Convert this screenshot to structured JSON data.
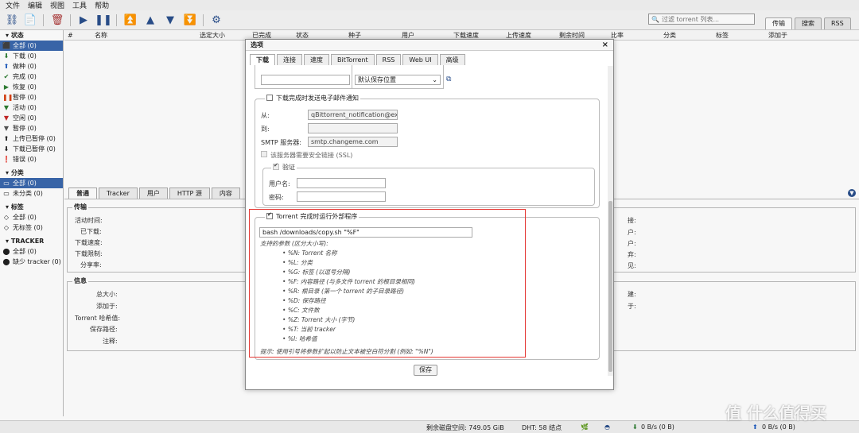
{
  "menu": {
    "file": "文件",
    "edit": "编辑",
    "view": "视图",
    "tools": "工具",
    "help": "帮助"
  },
  "search": {
    "placeholder": "过滤 torrent 列表..."
  },
  "right_tabs": [
    "传输",
    "搜索",
    "RSS"
  ],
  "sidebar": {
    "status_header": "状态",
    "status_items": [
      "全部 (0)",
      "下载 (0)",
      "做种 (0)",
      "完成 (0)",
      "恢复 (0)",
      "暂停 (0)",
      "活动 (0)",
      "空闲 (0)",
      "暂停 (0)",
      "上传已暂停 (0)",
      "下载已暂停 (0)",
      "错误 (0)"
    ],
    "category_header": "分类",
    "category_items": [
      "全部 (0)",
      "未分类 (0)"
    ],
    "tag_header": "标签",
    "tag_items": [
      "全部 (0)",
      "无标签 (0)"
    ],
    "tracker_header": "TRACKER",
    "tracker_items": [
      "全部 (0)",
      "缺少 tracker (0)"
    ]
  },
  "columns": [
    "#",
    "名称",
    "选定大小",
    "已完成",
    "状态",
    "种子",
    "用户",
    "下载速度",
    "上传速度",
    "剩余时间",
    "比率",
    "分类",
    "标签",
    "添加于"
  ],
  "bottom_tabs": [
    "普通",
    "Tracker",
    "用户",
    "HTTP 源",
    "内容"
  ],
  "transfer": {
    "legend": "传输",
    "labels": [
      "活动时间:",
      "已下载:",
      "下载速度:",
      "下载限制:",
      "分享率:"
    ],
    "right_labels": [
      "接:",
      "户:",
      "户:",
      "弃:",
      "见:"
    ]
  },
  "info": {
    "legend": "信息",
    "labels": [
      "总大小:",
      "添加于:",
      "Torrent 哈希值:",
      "保存路径:",
      "注释:"
    ],
    "right_labels": [
      "建:",
      "于:"
    ]
  },
  "status_bar": {
    "disk": "剩余磁盘空间: 749.05 GiB",
    "dht": "DHT: 58 结点",
    "down": "0 B/s (0 B)",
    "up": "0 B/s (0 B)"
  },
  "dialog": {
    "title": "选项",
    "close": "×",
    "tabs": [
      "下载",
      "连接",
      "速度",
      "BitTorrent",
      "RSS",
      "Web UI",
      "高级"
    ],
    "save_path_select": "默认保存位置",
    "email": {
      "legend": "下载完成时发送电子邮件通知",
      "from_label": "从:",
      "from_value": "qBittorrent_notification@exa",
      "to_label": "到:",
      "smtp_label": "SMTP 服务器:",
      "smtp_value": "smtp.changeme.com",
      "ssl_label": "该服务器需要安全链接 (SSL)",
      "auth_legend": "验证",
      "user_label": "用户名:",
      "pass_label": "密码:"
    },
    "run": {
      "legend": "Torrent 完成时运行外部程序",
      "command": "bash /downloads/copy.sh \"%F\"",
      "params_title": "支持的参数 (区分大小写):",
      "params": [
        "%N: Torrent 名称",
        "%L: 分类",
        "%G: 标签 (以逗号分隔)",
        "%F: 内容路径 (与多文件 torrent 的根目录相同)",
        "%R: 根目录 (第一个 torrent 的子目录路径)",
        "%D: 保存路径",
        "%C: 文件数",
        "%Z: Torrent 大小 (字节)",
        "%T: 当前 tracker",
        "%I: 哈希值"
      ],
      "hint": "提示: 使用引号将参数扩起以防止文本被空白符分割 (例如: \"%N\")"
    },
    "save_button": "保存"
  },
  "watermark": "值 什么值得买",
  "colors": {
    "selected": "#3a68ad",
    "highlight_box": "#e53935",
    "accent": "#2a4f8c"
  }
}
